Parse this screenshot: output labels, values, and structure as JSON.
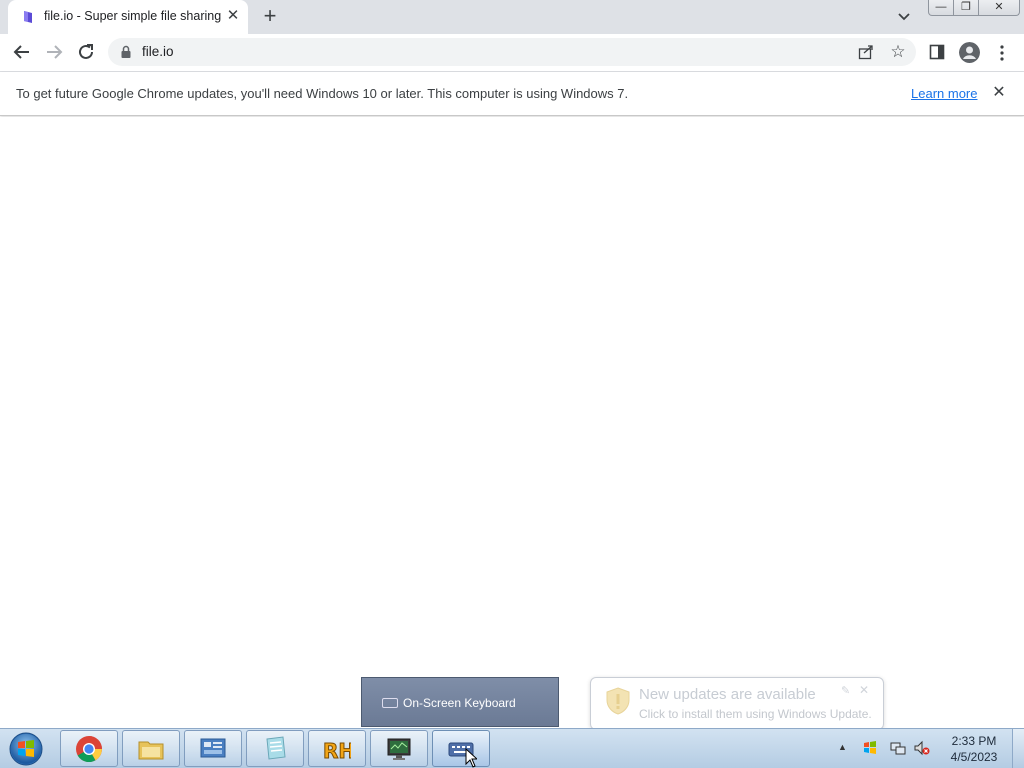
{
  "browser": {
    "tab": {
      "title": "file.io - Super simple file sharing",
      "close_label": "✕"
    },
    "new_tab_label": "+",
    "omnibox": {
      "url": "file.io"
    },
    "infobar": {
      "message": "To get future Google Chrome updates, you'll need Windows 10 or later. This computer is using Windows 7.",
      "link_label": "Learn more",
      "close_label": "✕"
    },
    "icons": [
      "favicon-icon",
      "back-icon",
      "forward-icon",
      "reload-icon",
      "lock-icon",
      "share-icon",
      "star-icon",
      "side-panel-icon",
      "profile-icon",
      "menu-icon",
      "tab-search-icon"
    ]
  },
  "window_controls": {
    "minimize": "—",
    "maximize": "❐",
    "close": "✕"
  },
  "thumbnail_popup": {
    "label": "On-Screen Keyboard"
  },
  "notification": {
    "title": "New updates are available",
    "subtitle": "Click to install them using Windows Update."
  },
  "taskbar": {
    "items": [
      "chrome",
      "file-explorer",
      "control-panel",
      "notepad-app",
      "rh-app",
      "monitor-app",
      "on-screen-keyboard"
    ],
    "clock": {
      "time": "2:33 PM",
      "date": "4/5/2023"
    }
  },
  "colors": {
    "tabbar": "#dee1e6",
    "link": "#1a73e8",
    "taskbar": "#b4cce3"
  }
}
